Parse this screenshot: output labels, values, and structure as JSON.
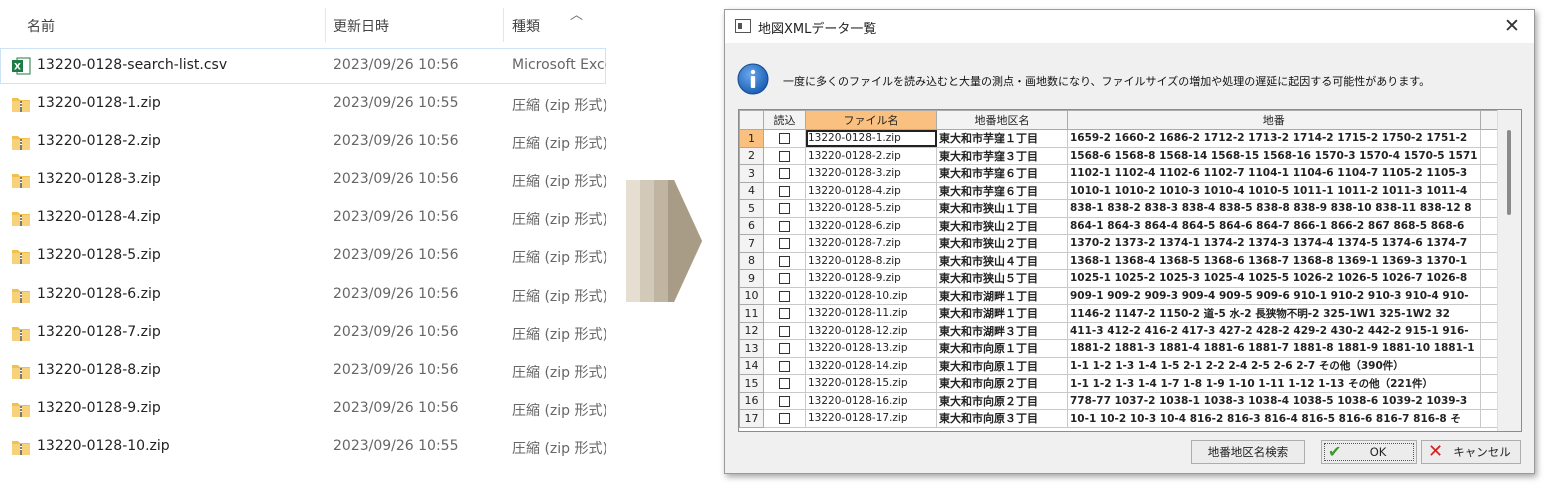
{
  "explorer": {
    "columns": {
      "name": "名前",
      "date": "更新日時",
      "type": "種類"
    },
    "files": [
      {
        "name": "13220-0128-search-list.csv",
        "date": "2023/09/26 10:56",
        "type": "Microsoft Exce",
        "icon": "excel-file-icon"
      },
      {
        "name": "13220-0128-1.zip",
        "date": "2023/09/26 10:55",
        "type": "圧縮 (zip 形式)",
        "icon": "zip-folder-icon"
      },
      {
        "name": "13220-0128-2.zip",
        "date": "2023/09/26 10:56",
        "type": "圧縮 (zip 形式)",
        "icon": "zip-folder-icon"
      },
      {
        "name": "13220-0128-3.zip",
        "date": "2023/09/26 10:56",
        "type": "圧縮 (zip 形式)",
        "icon": "zip-folder-icon"
      },
      {
        "name": "13220-0128-4.zip",
        "date": "2023/09/26 10:56",
        "type": "圧縮 (zip 形式)",
        "icon": "zip-folder-icon"
      },
      {
        "name": "13220-0128-5.zip",
        "date": "2023/09/26 10:56",
        "type": "圧縮 (zip 形式)",
        "icon": "zip-folder-icon"
      },
      {
        "name": "13220-0128-6.zip",
        "date": "2023/09/26 10:56",
        "type": "圧縮 (zip 形式)",
        "icon": "zip-folder-icon"
      },
      {
        "name": "13220-0128-7.zip",
        "date": "2023/09/26 10:56",
        "type": "圧縮 (zip 形式)",
        "icon": "zip-folder-icon"
      },
      {
        "name": "13220-0128-8.zip",
        "date": "2023/09/26 10:56",
        "type": "圧縮 (zip 形式)",
        "icon": "zip-folder-icon"
      },
      {
        "name": "13220-0128-9.zip",
        "date": "2023/09/26 10:56",
        "type": "圧縮 (zip 形式)",
        "icon": "zip-folder-icon"
      },
      {
        "name": "13220-0128-10.zip",
        "date": "2023/09/26 10:55",
        "type": "圧縮 (zip 形式)",
        "icon": "zip-folder-icon"
      }
    ]
  },
  "dialog": {
    "title": "地図XMLデータ一覧",
    "message": "一度に多くのファイルを読み込むと大量の測点・画地数になり、ファイルサイズの増加や処理の遅延に起因する可能性があります。",
    "grid": {
      "headers": {
        "row": "",
        "load": "読込",
        "file": "ファイル名",
        "area": "地番地区名",
        "lot": "地番"
      },
      "rows": [
        {
          "n": "1",
          "file": "13220-0128-1.zip",
          "area": "東大和市芋窪１丁目",
          "lot": "1659-2 1660-2 1686-2 1712-2 1713-2 1714-2 1715-2 1750-2 1751-2"
        },
        {
          "n": "2",
          "file": "13220-0128-2.zip",
          "area": "東大和市芋窪３丁目",
          "lot": "1568-6 1568-8 1568-14 1568-15 1568-16 1570-3 1570-4 1570-5 1571"
        },
        {
          "n": "3",
          "file": "13220-0128-3.zip",
          "area": "東大和市芋窪６丁目",
          "lot": "1102-1 1102-4 1102-6 1102-7 1104-1 1104-6 1104-7 1105-2 1105-3"
        },
        {
          "n": "4",
          "file": "13220-0128-4.zip",
          "area": "東大和市芋窪６丁目",
          "lot": "1010-1 1010-2 1010-3 1010-4 1010-5 1011-1 1011-2 1011-3 1011-4"
        },
        {
          "n": "5",
          "file": "13220-0128-5.zip",
          "area": "東大和市狭山１丁目",
          "lot": "838-1 838-2 838-3 838-4 838-5 838-8 838-9 838-10 838-11 838-12 8"
        },
        {
          "n": "6",
          "file": "13220-0128-6.zip",
          "area": "東大和市狭山２丁目",
          "lot": "864-1 864-3 864-4 864-5 864-6 864-7 866-1 866-2 867 868-5 868-6"
        },
        {
          "n": "7",
          "file": "13220-0128-7.zip",
          "area": "東大和市狭山２丁目",
          "lot": "1370-2 1373-2 1374-1 1374-2 1374-3 1374-4 1374-5 1374-6 1374-7"
        },
        {
          "n": "8",
          "file": "13220-0128-8.zip",
          "area": "東大和市狭山４丁目",
          "lot": "1368-1 1368-4 1368-5 1368-6 1368-7 1368-8 1369-1 1369-3 1370-1"
        },
        {
          "n": "9",
          "file": "13220-0128-9.zip",
          "area": "東大和市狭山５丁目",
          "lot": "1025-1 1025-2 1025-3 1025-4 1025-5 1026-2 1026-5 1026-7 1026-8"
        },
        {
          "n": "10",
          "file": "13220-0128-10.zip",
          "area": "東大和市湖畔１丁目",
          "lot": "909-1 909-2 909-3 909-4 909-5 909-6 910-1 910-2 910-3 910-4 910-"
        },
        {
          "n": "11",
          "file": "13220-0128-11.zip",
          "area": "東大和市湖畔１丁目",
          "lot": "1146-2 1147-2 1150-2 道-5 水-2 長狭物不明-2 325-1W1 325-1W2 32"
        },
        {
          "n": "12",
          "file": "13220-0128-12.zip",
          "area": "東大和市湖畔３丁目",
          "lot": "411-3 412-2 416-2 417-3 427-2 428-2 429-2 430-2 442-2 915-1 916-"
        },
        {
          "n": "13",
          "file": "13220-0128-13.zip",
          "area": "東大和市向原１丁目",
          "lot": "1881-2 1881-3 1881-4 1881-6 1881-7 1881-8 1881-9 1881-10 1881-1"
        },
        {
          "n": "14",
          "file": "13220-0128-14.zip",
          "area": "東大和市向原１丁目",
          "lot": "1-1 1-2 1-3 1-4 1-5 2-1 2-2 2-4 2-5 2-6 2-7 その他（390件）"
        },
        {
          "n": "15",
          "file": "13220-0128-15.zip",
          "area": "東大和市向原２丁目",
          "lot": "1-1 1-2 1-3 1-4 1-7 1-8 1-9 1-10 1-11 1-12 1-13 その他（221件）"
        },
        {
          "n": "16",
          "file": "13220-0128-16.zip",
          "area": "東大和市向原２丁目",
          "lot": "778-77 1037-2 1038-1 1038-3 1038-4 1038-5 1038-6 1039-2 1039-3"
        },
        {
          "n": "17",
          "file": "13220-0128-17.zip",
          "area": "東大和市向原３丁目",
          "lot": "10-1 10-2 10-3 10-4 816-2 816-3 816-4 816-5 816-6 816-7 816-8 そ"
        }
      ]
    },
    "buttons": {
      "search": "地番地区名検索",
      "ok": "OK",
      "cancel": "キャンセル"
    }
  },
  "colors": {
    "selected_header": "#f9c07f",
    "arrow": "#b0a48f",
    "info_blue": "#1c5fb6",
    "ok_green": "#3b9a2a",
    "cancel_red": "#d42020"
  }
}
